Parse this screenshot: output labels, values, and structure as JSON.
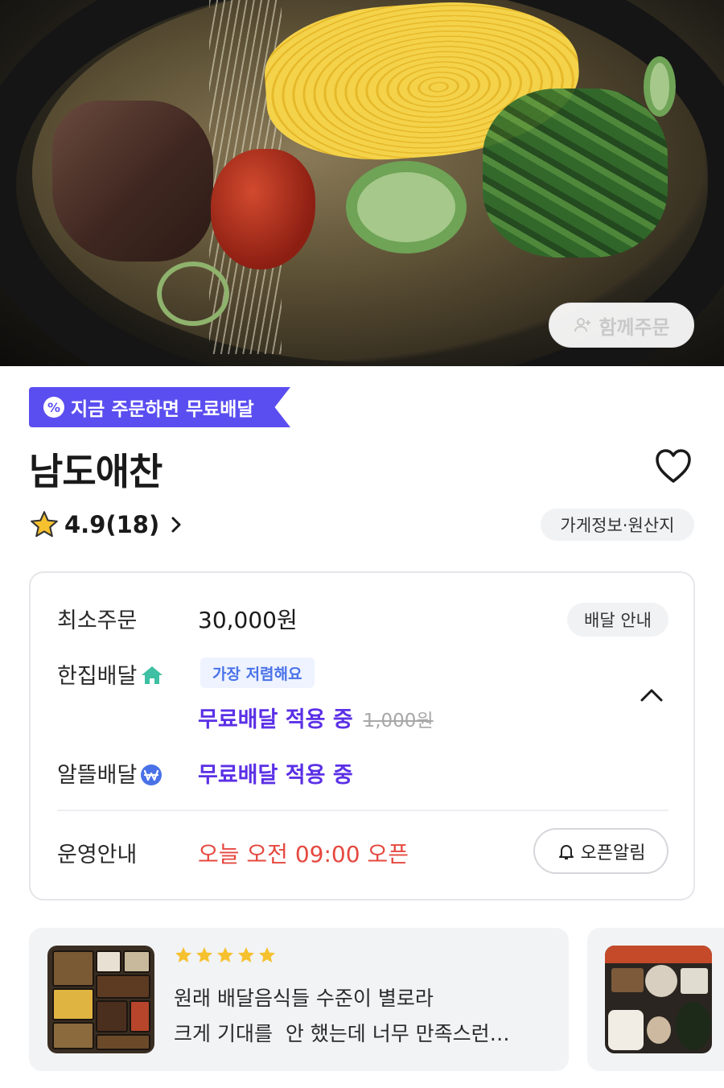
{
  "hero": {
    "photo_icon": "food-photo",
    "together_order_label": "함께주문"
  },
  "promo": {
    "badge_icon": "percent-badge-icon",
    "text": "지금 주문하면 무료배달",
    "color": "#5b4ef0"
  },
  "store": {
    "name": "남도애찬",
    "rating_text": "4.9(18)",
    "rating_value": 4.9,
    "review_count": 18,
    "info_chip": "가게정보·원산지"
  },
  "info": {
    "min_order_label": "최소주문",
    "min_order_value": "30,000원",
    "delivery_guide": "배달 안내",
    "hanjip_label": "한집배달",
    "cheapest_badge": "가장 저렴해요",
    "hanjip_value": "무료배달 적용 중",
    "hanjip_original_fee": "1,000원",
    "aldeul_label": "알뜰배달",
    "aldeul_value": "무료배달 적용 중",
    "hours_label": "운영안내",
    "hours_value": "오늘 오전 09:00 오픈",
    "open_alarm": "오픈알림"
  },
  "reviews": [
    {
      "stars": 5,
      "text_line1": "원래 배달음식들 수준이 별로라",
      "text_line2": "크게 기대를  안 했는데 너무 만족스런…"
    }
  ],
  "colors": {
    "accent": "#5b30e6",
    "hours_red": "#e5483f",
    "star_yellow": "#f5c12e",
    "chip_bg": "#f1f2f4"
  }
}
